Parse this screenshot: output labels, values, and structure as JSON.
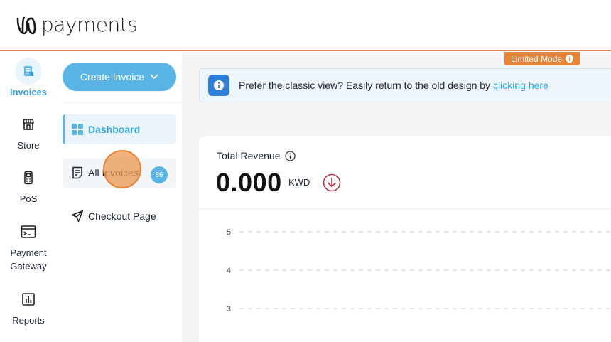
{
  "header": {
    "logo_text": "payments",
    "border_color": "#e8833a"
  },
  "rail": {
    "items": [
      {
        "label": "Invoices",
        "icon": "invoice-icon",
        "active": true
      },
      {
        "label": "Store",
        "icon": "store-icon"
      },
      {
        "label": "PoS",
        "icon": "pos-terminal-icon"
      },
      {
        "label": "Payment\nGateway",
        "icon": "terminal-window-icon"
      },
      {
        "label": "Reports",
        "icon": "bar-chart-icon"
      }
    ]
  },
  "subnav": {
    "create_label": "Create Invoice",
    "items": [
      {
        "label": "Dashboard",
        "icon": "dashboard-grid-icon",
        "active": true
      },
      {
        "label": "All Invoices",
        "icon": "document-lines-icon",
        "badge": "86"
      },
      {
        "label": "Checkout Page",
        "icon": "send-plane-icon"
      }
    ]
  },
  "main": {
    "limited_mode": "Limited Mode",
    "banner": {
      "text": "Prefer the classic view? Easily return to the old design by",
      "link": "clicking here"
    },
    "revenue": {
      "label": "Total Revenue",
      "value": "0.000",
      "unit": "KWD",
      "trend": "down"
    }
  },
  "chart_data": {
    "type": "line",
    "y_ticks": [
      5,
      4,
      3
    ],
    "grid": true
  },
  "colors": {
    "accent": "#5ab4e5",
    "accent_text": "#3aa5dc",
    "orange": "#e8833a",
    "trend_down": "#b03a48"
  }
}
